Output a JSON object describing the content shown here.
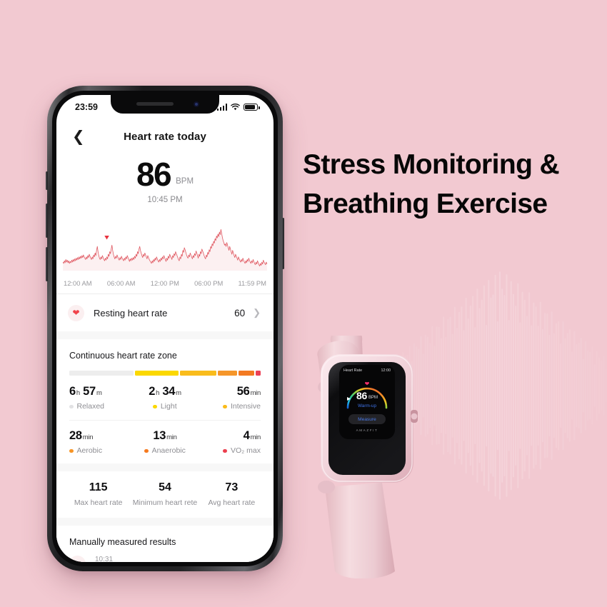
{
  "background": {
    "color": "#f2c9d1",
    "wave_color": "#f7dde2"
  },
  "headline": {
    "line1": "Stress Monitoring &",
    "line2": "Breathing Exercise",
    "color": "#070707"
  },
  "phone": {
    "status_bar": {
      "time": "23:59",
      "signal_icon": "signal-bars-icon",
      "wifi_icon": "wifi-icon",
      "battery_icon": "battery-icon"
    },
    "header": {
      "back_icon": "chevron-left-icon",
      "title": "Heart rate today"
    },
    "current": {
      "value": "86",
      "unit": "BPM",
      "time": "10:45 PM"
    },
    "chart_axis": [
      "12:00 AM",
      "06:00 AM",
      "12:00 PM",
      "06:00 PM",
      "11:59 PM"
    ],
    "resting": {
      "icon": "heart-icon",
      "label": "Resting heart rate",
      "value": "60",
      "chevron": "chevron-right-icon"
    },
    "zone": {
      "title": "Continuous heart rate zone",
      "bar": [
        {
          "color": "#ededed",
          "flex": 37
        },
        {
          "color": "#fbd800",
          "flex": 25
        },
        {
          "color": "#f9bc1c",
          "flex": 21
        },
        {
          "color": "#f5962a",
          "flex": 11
        },
        {
          "color": "#f37a22",
          "flex": 9
        },
        {
          "color": "#ec4055",
          "flex": 3
        }
      ],
      "rows": [
        [
          {
            "value": "6",
            "unit1": "h",
            "value2": "57",
            "unit2": "m",
            "label": "Relaxed",
            "dot": "#e2e2e4"
          },
          {
            "value": "2",
            "unit1": "h",
            "value2": "34",
            "unit2": "m",
            "label": "Light",
            "dot": "#fbd800"
          },
          {
            "value": "56",
            "unit1": "min",
            "value2": "",
            "unit2": "",
            "label": "Intensive",
            "dot": "#fabb1a"
          }
        ],
        [
          {
            "value": "28",
            "unit1": "min",
            "value2": "",
            "unit2": "",
            "label": "Aerobic",
            "dot": "#f79526"
          },
          {
            "value": "13",
            "unit1": "min",
            "value2": "",
            "unit2": "",
            "label": "Anaerobic",
            "dot": "#f57a1f"
          },
          {
            "value": "4",
            "unit1": "min",
            "value2": "",
            "unit2": "",
            "label": "VO₂ max",
            "dot": "#ec3f4f"
          }
        ]
      ]
    },
    "stats": [
      {
        "value": "115",
        "label": "Max heart rate"
      },
      {
        "value": "54",
        "label": "Minimum heart rete"
      },
      {
        "value": "73",
        "label": "Avg heart rate"
      }
    ],
    "manual": {
      "title": "Manually measured results",
      "icon": "heart-icon",
      "time": "10:31"
    }
  },
  "watch": {
    "screen": {
      "title": "Heart Rate",
      "time": "12:00",
      "heart_icon": "heart-icon",
      "bpm": "86",
      "unit": "BPM",
      "state": "Warm-up",
      "button": "Measure",
      "brand": "AMAZFIT"
    }
  },
  "chart_data": {
    "type": "line",
    "title": "Heart rate today",
    "xlabel": "",
    "ylabel": "BPM",
    "x_ticks": [
      "12:00 AM",
      "06:00 AM",
      "12:00 PM",
      "06:00 PM",
      "11:59 PM"
    ],
    "line_color": "#e05a63",
    "fill_color": "#fbeced",
    "marker": {
      "type": "triangle-down",
      "color": "#e8323f",
      "x_fraction": 0.215
    },
    "ylim": [
      50,
      120
    ],
    "values": [
      62,
      60,
      64,
      61,
      66,
      62,
      65,
      61,
      64,
      60,
      63,
      61,
      65,
      62,
      66,
      63,
      67,
      64,
      68,
      65,
      69,
      66,
      70,
      67,
      71,
      68,
      72,
      69,
      73,
      70,
      68,
      66,
      70,
      67,
      72,
      69,
      74,
      71,
      68,
      66,
      70,
      67,
      73,
      70,
      76,
      72,
      80,
      86,
      78,
      72,
      68,
      66,
      70,
      67,
      72,
      69,
      66,
      64,
      68,
      65,
      70,
      67,
      74,
      71,
      78,
      75,
      82,
      88,
      80,
      74,
      70,
      67,
      71,
      68,
      73,
      70,
      67,
      65,
      69,
      66,
      71,
      68,
      66,
      64,
      68,
      65,
      70,
      67,
      72,
      69,
      66,
      63,
      67,
      64,
      68,
      65,
      69,
      66,
      71,
      68,
      74,
      71,
      78,
      75,
      82,
      86,
      80,
      76,
      72,
      69,
      74,
      71,
      76,
      73,
      70,
      67,
      72,
      69,
      66,
      64,
      62,
      60,
      64,
      61,
      66,
      63,
      68,
      65,
      70,
      67,
      64,
      62,
      66,
      63,
      68,
      65,
      70,
      67,
      72,
      69,
      66,
      63,
      68,
      65,
      71,
      68,
      74,
      71,
      69,
      66,
      72,
      69,
      75,
      72,
      78,
      75,
      72,
      69,
      66,
      64,
      70,
      67,
      74,
      71,
      80,
      77,
      84,
      81,
      77,
      73,
      70,
      68,
      73,
      70,
      76,
      73,
      70,
      67,
      72,
      69,
      75,
      72,
      79,
      76,
      72,
      68,
      74,
      71,
      78,
      75,
      82,
      79,
      76,
      72,
      69,
      67,
      73,
      70,
      77,
      74,
      81,
      78,
      86,
      83,
      90,
      87,
      94,
      91,
      98,
      95,
      102,
      99,
      105,
      101,
      108,
      104,
      112,
      106,
      100,
      95,
      92,
      88,
      90,
      86,
      92,
      88,
      84,
      80,
      86,
      82,
      78,
      74,
      80,
      76,
      72,
      69,
      74,
      71,
      68,
      65,
      70,
      67,
      64,
      62,
      66,
      63,
      68,
      65,
      62,
      60,
      64,
      61,
      66,
      63,
      68,
      65,
      62,
      60,
      64,
      61,
      66,
      63,
      60,
      58,
      62,
      59,
      64,
      61,
      58,
      56,
      60,
      57,
      62,
      59,
      65,
      62,
      60,
      58,
      62,
      59
    ]
  }
}
